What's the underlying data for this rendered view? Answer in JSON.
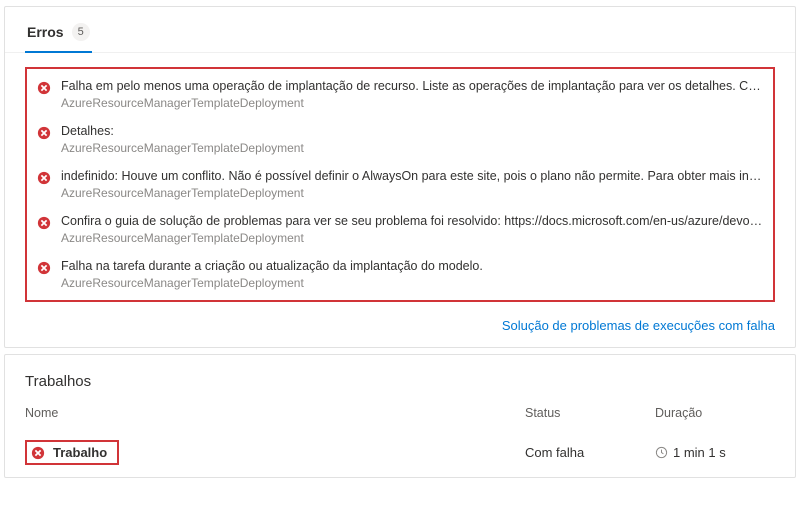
{
  "tabs": {
    "errors_label": "Erros",
    "errors_count": "5"
  },
  "errors": [
    {
      "message": "Falha em pelo menos uma operação de implantação de recurso. Liste as operações de implantação para ver os detalhes. Confira http://aka.ms...",
      "source": "AzureResourceManagerTemplateDeployment"
    },
    {
      "message": "Detalhes:",
      "source": "AzureResourceManagerTemplateDeployment"
    },
    {
      "message": "indefinido: Houve um conflito. Não é possível definir o AlwaysOn para este site, pois o plano não permite. Para obter mais informações sobre pr...",
      "source": "AzureResourceManagerTemplateDeployment"
    },
    {
      "message": "Confira o guia de solução de problemas para ver se seu problema foi resolvido: https://docs.microsoft.com/en-us/azure/devops/pipeline/tasks/...",
      "source": "AzureResourceManagerTemplateDeployment"
    },
    {
      "message": "Falha na tarefa durante a criação ou atualização da implantação do modelo.",
      "source": "AzureResourceManagerTemplateDeployment"
    }
  ],
  "troubleshoot_link": "Solução de problemas de execuções com falha",
  "jobs": {
    "section_title": "Trabalhos",
    "columns": {
      "name": "Nome",
      "status": "Status",
      "duration": "Duração"
    },
    "rows": [
      {
        "name": "Trabalho",
        "status": "Com falha",
        "duration": "1 min 1 s"
      }
    ]
  }
}
